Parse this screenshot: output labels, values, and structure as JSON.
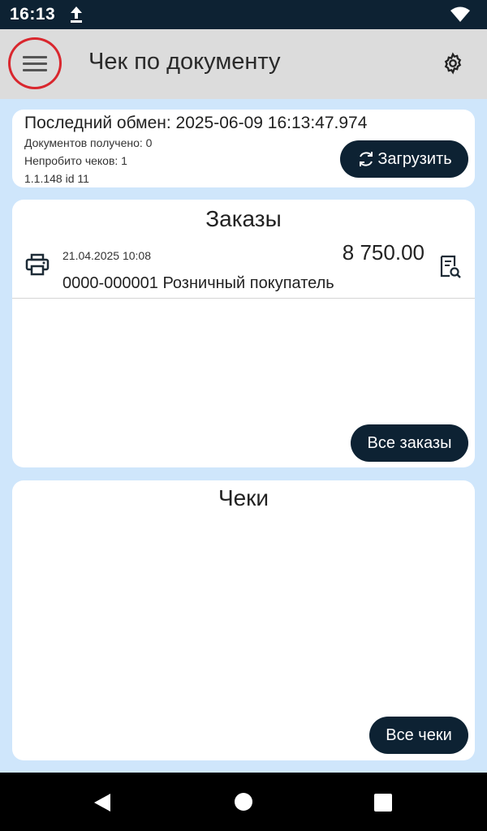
{
  "status_bar": {
    "time": "16:13",
    "upload_icon": "upload-icon",
    "wifi_icon": "wifi-icon"
  },
  "app_bar": {
    "title": "Чек по документу",
    "menu_icon": "menu-icon",
    "settings_icon": "gear-icon",
    "highlight_color": "#d9272e"
  },
  "exchange": {
    "last_exchange": "Последний обмен: 2025-06-09 16:13:47.974",
    "docs_received": "Документов получено: 0",
    "unprinted": "Непробито чеков: 1",
    "version": "1.1.148 id 11",
    "load_label": "Загрузить",
    "load_icon": "refresh-icon"
  },
  "orders": {
    "title": "Заказы",
    "items": [
      {
        "date": "21.04.2025 10:08",
        "sum": "8 750.00",
        "name": "0000-000001 Розничный покупатель",
        "print_icon": "printer-icon",
        "view_icon": "document-search-icon"
      }
    ],
    "all_label": "Все заказы"
  },
  "checks": {
    "title": "Чеки",
    "all_label": "Все чеки"
  },
  "nav": {
    "back_icon": "back-icon",
    "home_icon": "home-icon",
    "recent_icon": "recent-apps-icon"
  },
  "colors": {
    "background": "#cfe6fb",
    "dark_button": "#0d2233",
    "app_bar": "#dcdcdc"
  }
}
